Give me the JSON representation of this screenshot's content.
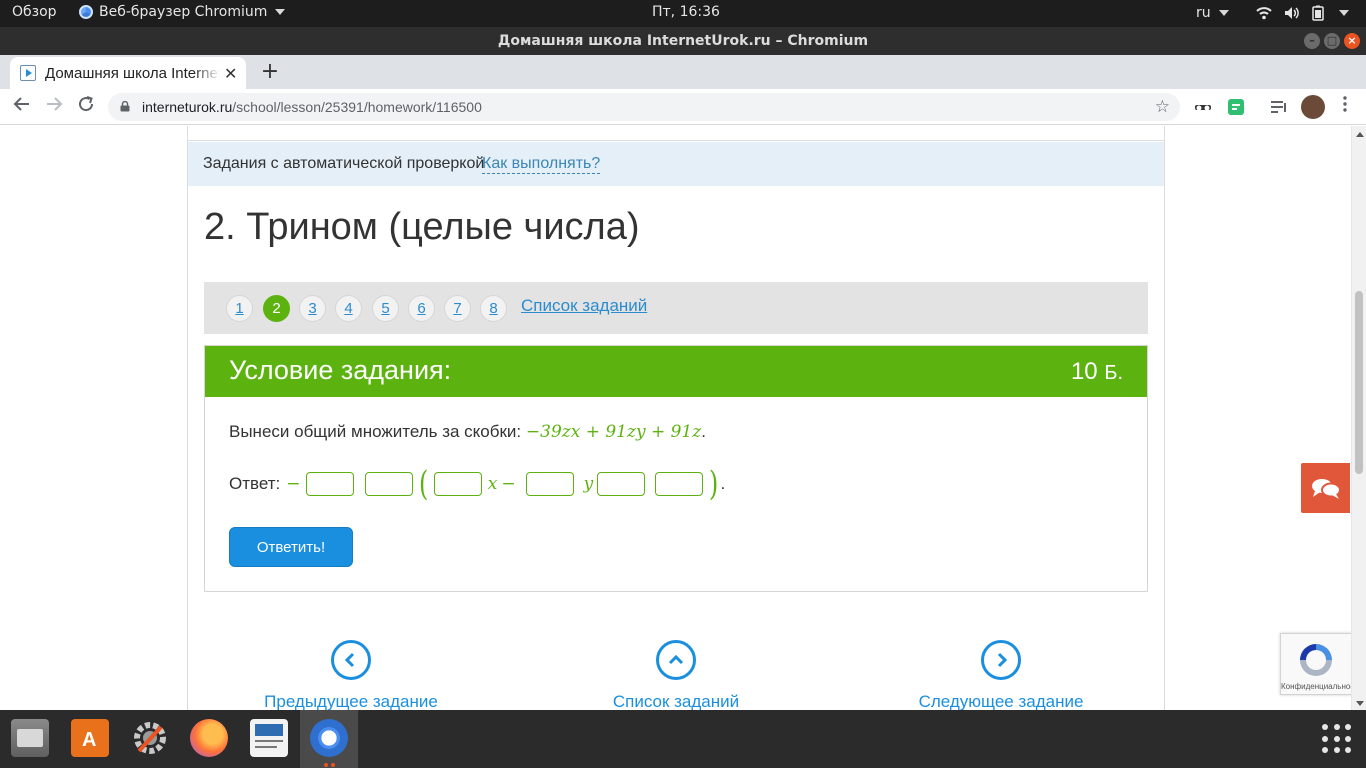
{
  "top_panel": {
    "overview": "Обзор",
    "app_menu": "Веб-браузер Chromium",
    "clock": "Пт, 16:36",
    "lang": "ru"
  },
  "window": {
    "title": "Домашняя школа InternetUrok.ru – Chromium"
  },
  "tab": {
    "title": "Домашняя школа InternetUrok.ru"
  },
  "toolbar": {
    "url_host": "interneturok.ru",
    "url_path": "/school/lesson/25391/homework/116500"
  },
  "page": {
    "info_label": "Задания с автоматической проверкой",
    "info_link": "Как выполнять?",
    "task_title": "2. Трином (целые числа)",
    "pager": {
      "pages": [
        "1",
        "2",
        "3",
        "4",
        "5",
        "6",
        "7",
        "8"
      ],
      "active_index": 1,
      "list_link": "Список заданий"
    },
    "task": {
      "header": "Условие задания:",
      "points_value": "10",
      "points_unit": "Б.",
      "question_text": "Вынеси общий множитель за скобки:",
      "expression": "−39zx + 91zy + 91z",
      "expression_end": ".",
      "answer_label": "Ответ:",
      "answer_minus": "−",
      "var_x": "x",
      "minus_sign": "−",
      "var_y": "y",
      "period": ".",
      "inputs": [
        "",
        "",
        "",
        "",
        "",
        ""
      ],
      "submit": "Ответить!"
    },
    "bottom_nav": {
      "prev": "Предыдущее задание",
      "list": "Список заданий",
      "next": "Следующее задание"
    },
    "recaptcha_text": "Конфиденциальность"
  },
  "colors": {
    "green": "#5cb310",
    "blue": "#1a8fe0",
    "feedback": "#e0573a",
    "ubuntu_orange": "#e95420"
  },
  "dock": {
    "items": [
      "files-icon",
      "software-center-icon",
      "settings-icon",
      "firefox-icon",
      "document-viewer-icon",
      "chromium-icon"
    ]
  }
}
